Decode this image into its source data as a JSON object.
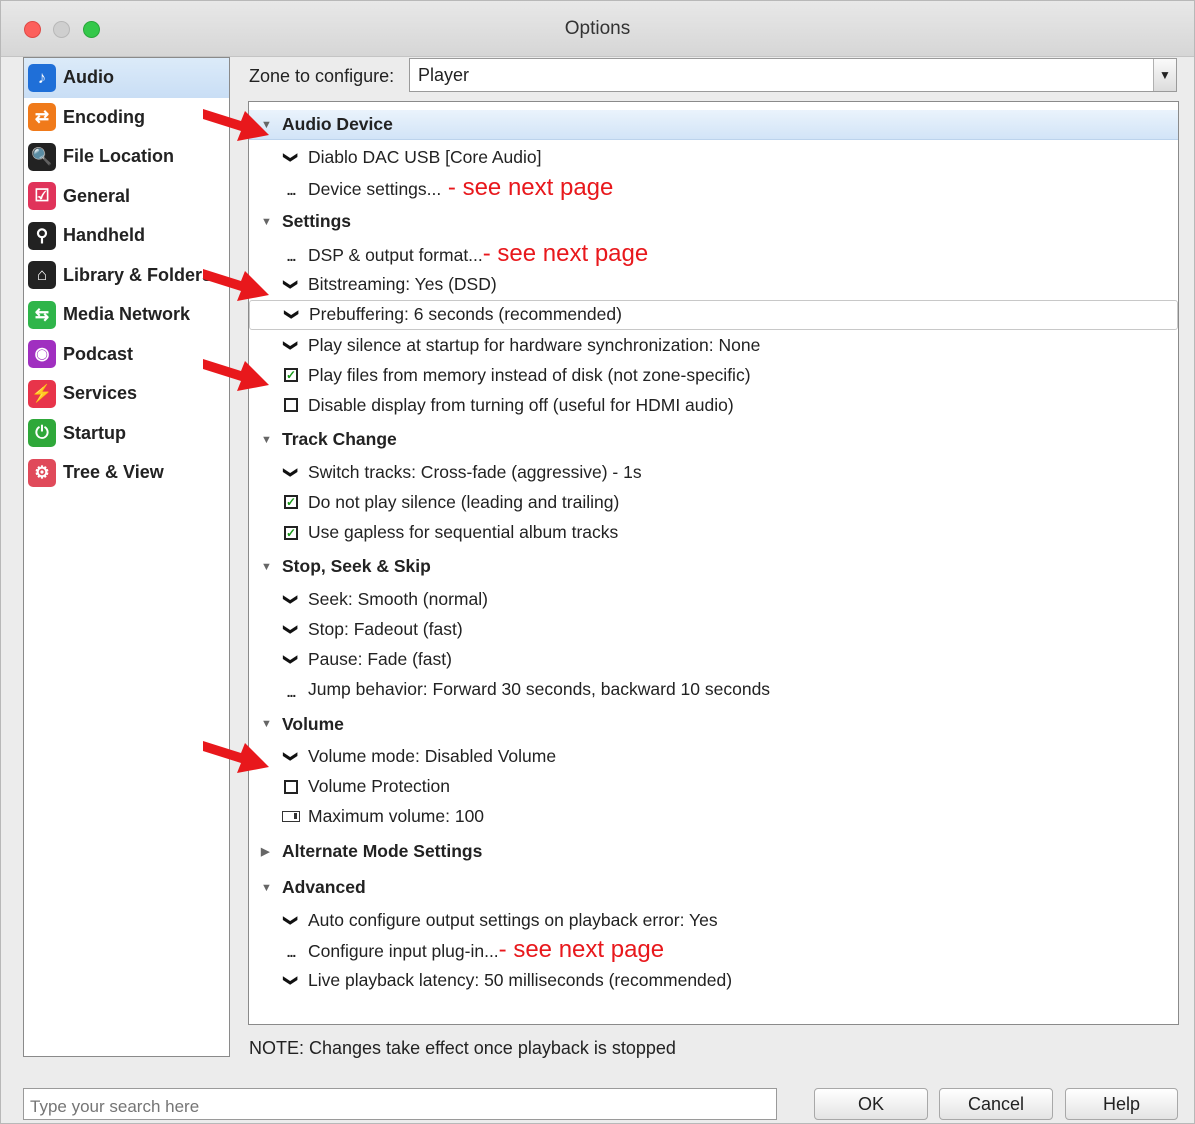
{
  "window": {
    "title": "Options"
  },
  "sidebar": {
    "items": [
      {
        "label": "Audio",
        "icon": "music-note-icon",
        "color": "#1f6fd8",
        "glyph": "♪",
        "selected": true
      },
      {
        "label": "Encoding",
        "icon": "encoding-icon",
        "color": "#f07a1a",
        "glyph": "⇄"
      },
      {
        "label": "File Location",
        "icon": "file-location-icon",
        "color": "#222222",
        "glyph": "🔍"
      },
      {
        "label": "General",
        "icon": "general-check-icon",
        "color": "#e0335a",
        "glyph": "☑"
      },
      {
        "label": "Handheld",
        "icon": "usb-icon",
        "color": "#222222",
        "glyph": "⚲"
      },
      {
        "label": "Library & Folders",
        "icon": "library-house-icon",
        "color": "#222222",
        "glyph": "⌂"
      },
      {
        "label": "Media Network",
        "icon": "network-icon",
        "color": "#2fb54a",
        "glyph": "⇆"
      },
      {
        "label": "Podcast",
        "icon": "podcast-icon",
        "color": "#a02fc0",
        "glyph": "◉"
      },
      {
        "label": "Services",
        "icon": "plug-icon",
        "color": "#e8344a",
        "glyph": "⚡"
      },
      {
        "label": "Startup",
        "icon": "power-icon",
        "color": "#2fa83a",
        "glyph": "⏻"
      },
      {
        "label": "Tree & View",
        "icon": "gear-icon",
        "color": "#e04a5a",
        "glyph": "⚙"
      }
    ]
  },
  "zone": {
    "label": "Zone to configure:",
    "value": "Player"
  },
  "tree": {
    "rows": [
      {
        "type": "section",
        "label": "Audio Device",
        "expanded": true,
        "highlight": true,
        "arrow": true
      },
      {
        "type": "chevron",
        "label": "Diablo DAC USB [Core Audio]"
      },
      {
        "type": "dots",
        "label": "Device settings...",
        "annotation": " - see next page"
      },
      {
        "type": "section",
        "label": "Settings",
        "expanded": true
      },
      {
        "type": "dots",
        "label": "DSP & output format...",
        "annotation": "- see next page"
      },
      {
        "type": "chevron",
        "label": "Bitstreaming: Yes (DSD)",
        "arrow": true
      },
      {
        "type": "chevron",
        "label": "Prebuffering: 6 seconds (recommended)",
        "boxed": true
      },
      {
        "type": "chevron",
        "label": "Play silence at startup for hardware synchronization: None"
      },
      {
        "type": "checkbox",
        "label": "Play files from memory instead of disk (not zone-specific)",
        "checked": true,
        "arrow": true
      },
      {
        "type": "checkbox",
        "label": "Disable display from turning off (useful for HDMI audio)",
        "checked": false
      },
      {
        "type": "section",
        "label": "Track Change",
        "expanded": true
      },
      {
        "type": "chevron",
        "label": "Switch tracks: Cross-fade (aggressive) - 1s"
      },
      {
        "type": "checkbox",
        "label": "Do not play silence (leading and trailing)",
        "checked": true
      },
      {
        "type": "checkbox",
        "label": "Use gapless for sequential album tracks",
        "checked": true
      },
      {
        "type": "section",
        "label": "Stop, Seek & Skip",
        "expanded": true
      },
      {
        "type": "chevron",
        "label": "Seek: Smooth (normal)"
      },
      {
        "type": "chevron",
        "label": "Stop: Fadeout (fast)"
      },
      {
        "type": "chevron",
        "label": "Pause: Fade (fast)"
      },
      {
        "type": "dots",
        "label": "Jump behavior: Forward 30 seconds, backward 10 seconds"
      },
      {
        "type": "section",
        "label": "Volume",
        "expanded": true
      },
      {
        "type": "chevron",
        "label": "Volume mode: Disabled Volume",
        "arrow": true
      },
      {
        "type": "checkbox",
        "label": "Volume Protection",
        "checked": false
      },
      {
        "type": "slider",
        "label": "Maximum volume: 100"
      },
      {
        "type": "section",
        "label": "Alternate Mode Settings",
        "expanded": false
      },
      {
        "type": "section",
        "label": "Advanced",
        "expanded": true
      },
      {
        "type": "chevron",
        "label": "Auto configure output settings on playback error: Yes"
      },
      {
        "type": "dots",
        "label": "Configure input plug-in...",
        "annotation": "- see next page"
      },
      {
        "type": "chevron",
        "label": "Live playback latency: 50 milliseconds (recommended)"
      }
    ]
  },
  "note": "NOTE: Changes take effect once playback is stopped",
  "search": {
    "placeholder": "Type your search here"
  },
  "buttons": {
    "ok": "OK",
    "cancel": "Cancel",
    "help": "Help"
  },
  "colors": {
    "annotation": "#e8181c",
    "arrow": "#e8181c",
    "selection": "#c9def5"
  }
}
